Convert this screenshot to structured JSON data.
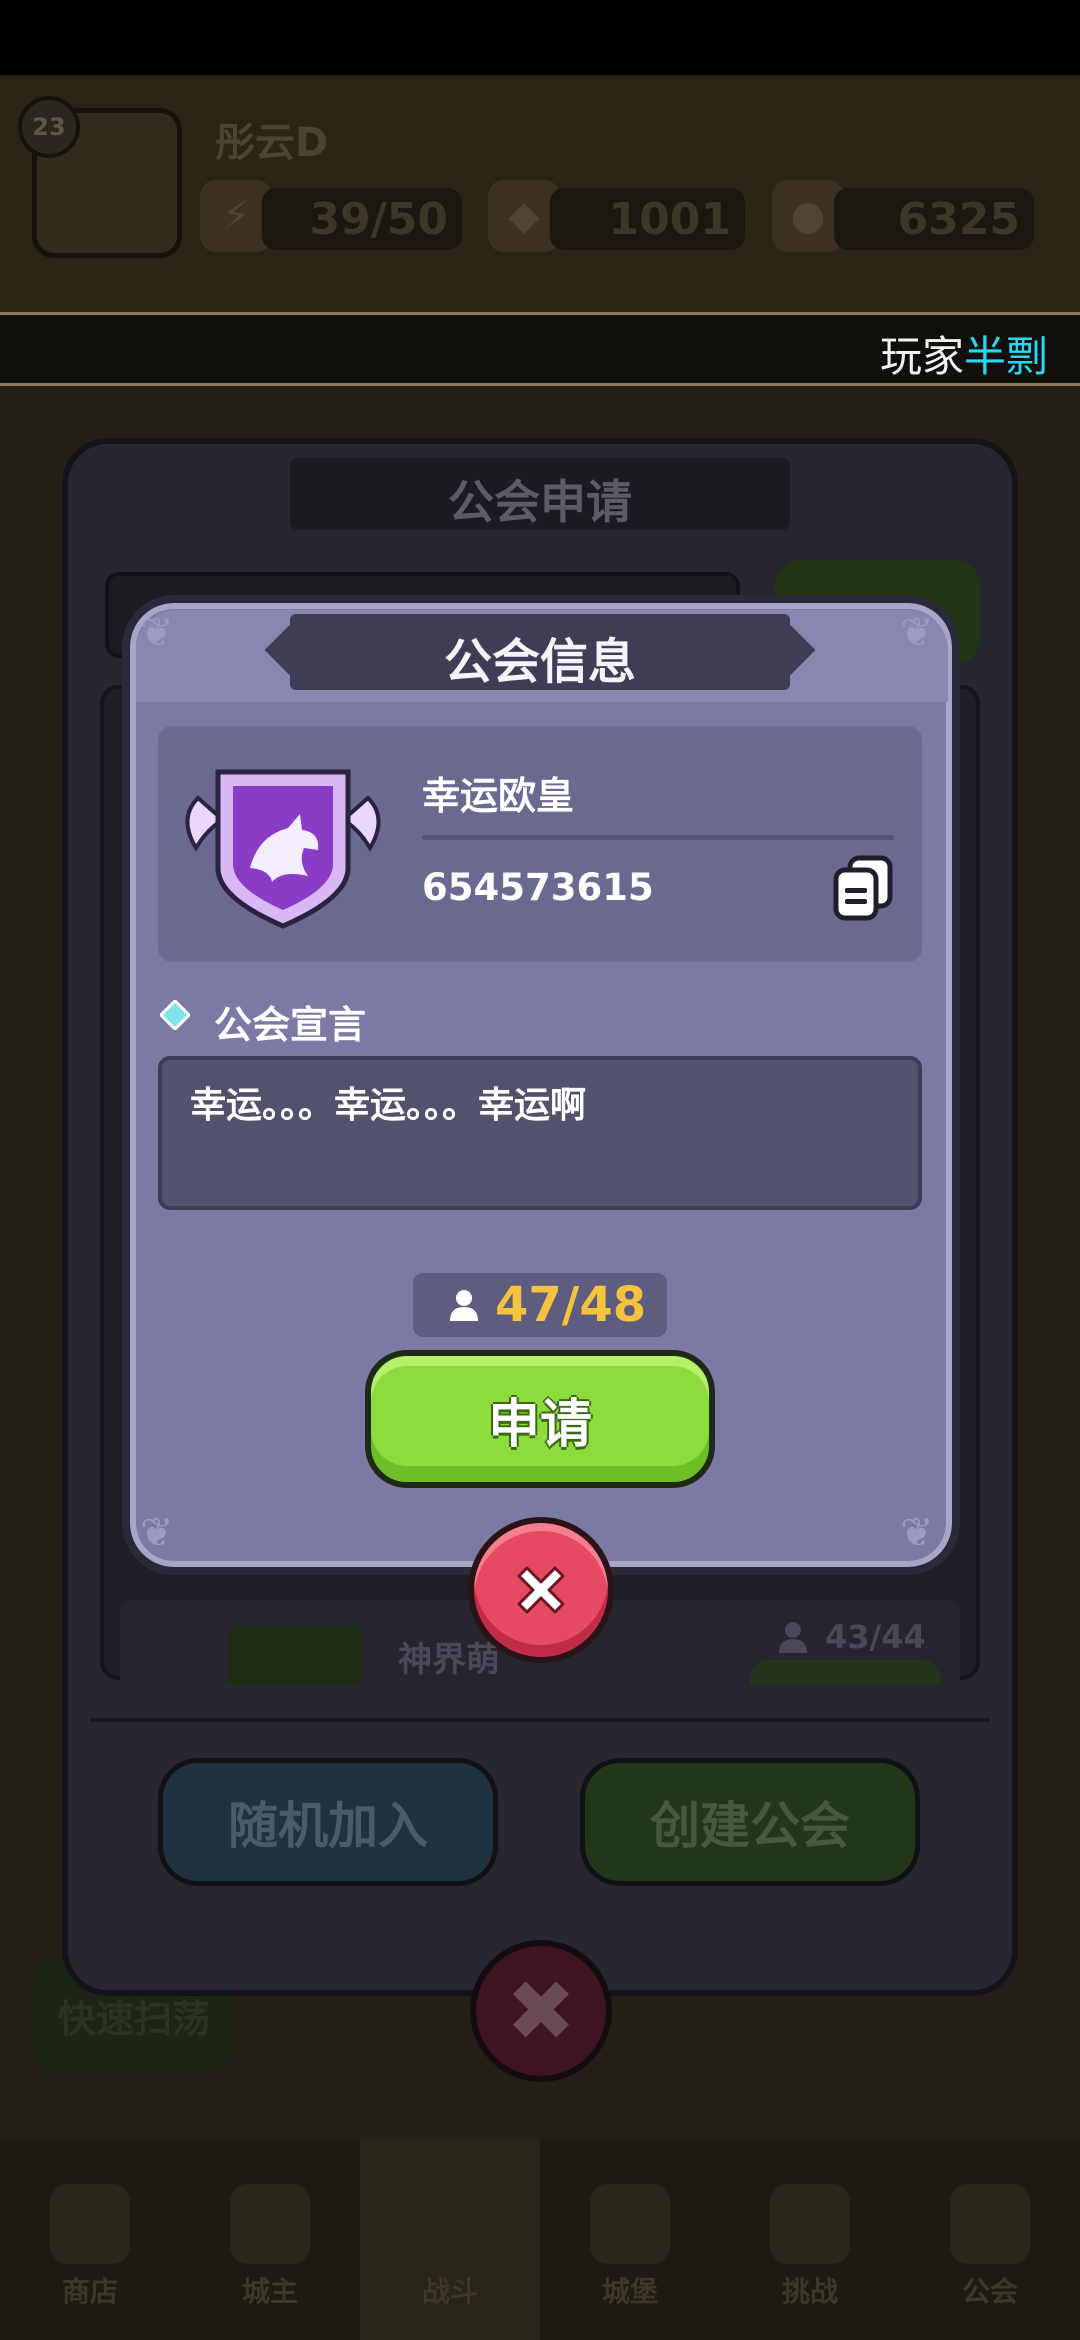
{
  "player": {
    "level": "23",
    "name": "彤云D"
  },
  "resources": {
    "energy": "39/50",
    "gems": "1001",
    "gold": "6325"
  },
  "ticker": {
    "prefix": "玩家",
    "highlight": "半剽"
  },
  "background_panel": {
    "title": "公会申请",
    "list_row": {
      "name": "神界萌",
      "members": "43/44"
    },
    "random_join_label": "随机加入",
    "create_guild_label": "创建公会"
  },
  "quick_sweep_label": "快速扫荡",
  "bottom_nav": [
    {
      "label": "商店"
    },
    {
      "label": "城主"
    },
    {
      "label": "战斗"
    },
    {
      "label": "城堡"
    },
    {
      "label": "挑战"
    },
    {
      "label": "公会"
    }
  ],
  "dialog": {
    "title": "公会信息",
    "guild_name": "幸运欧皇",
    "guild_id": "654573615",
    "manifesto_label": "公会宣言",
    "manifesto_text": "幸运。。。幸运。。。幸运啊",
    "members": "47/48",
    "apply_label": "申请"
  },
  "icons": {
    "emblem": "dragon-shield-emblem-icon",
    "copy": "copy-icon",
    "diamond": "diamond-bullet-icon",
    "user": "user-icon",
    "close": "close-icon"
  },
  "colors": {
    "dialog_bg": "#7b7aa4",
    "apply_green": "#8ddc3d",
    "close_red": "#e64a63",
    "member_count_gold": "#f5c33e",
    "ticker_highlight": "#27d8f2"
  }
}
